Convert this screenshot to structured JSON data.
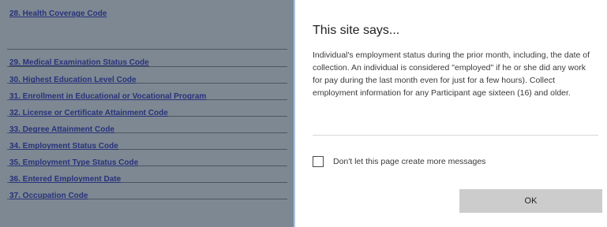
{
  "background_page": {
    "items": [
      {
        "label": "28. Health Coverage Code"
      },
      {
        "label": "29. Medical Examination Status Code"
      },
      {
        "label": "30. Highest Education Level Code"
      },
      {
        "label": "31. Enrollment in Educational or Vocational Program"
      },
      {
        "label": "32. License or Certificate Attainment Code"
      },
      {
        "label": "33. Degree Attainment Code"
      },
      {
        "label": "34. Employment Status Code"
      },
      {
        "label": "35. Employment Type Status Code"
      },
      {
        "label": "36. Entered Employment Date"
      },
      {
        "label": "37. Occupation Code"
      }
    ]
  },
  "dialog": {
    "title": "This site says...",
    "message": "Individual's employment status during the prior month, including, the date of collection. An individual is considered \"employed\" if he or she did any work for pay during the last month even for just for a few hours). Collect employment information for any Participant age sixteen (16) and older.",
    "checkbox_label": "Don't let this page create more messages",
    "checkbox_checked": false,
    "ok_label": "OK"
  }
}
